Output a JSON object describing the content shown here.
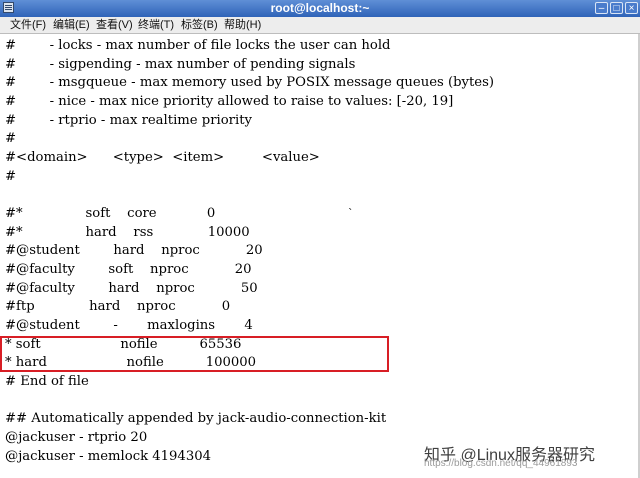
{
  "window": {
    "title": "root@localhost:~"
  },
  "menu": [
    {
      "label": "文件(F)"
    },
    {
      "label": "编辑(E)"
    },
    {
      "label": "查看(V)"
    },
    {
      "label": "终端(T)"
    },
    {
      "label": "标签(B)"
    },
    {
      "label": "帮助(H)"
    }
  ],
  "terminal": {
    "lines": [
      "#        - locks - max number of file locks the user can hold",
      "#        - sigpending - max number of pending signals",
      "#        - msgqueue - max memory used by POSIX message queues (bytes)",
      "#        - nice - max nice priority allowed to raise to values: [-20, 19]",
      "#        - rtprio - max realtime priority",
      "#",
      "#<domain>      <type>  <item>         <value>",
      "#",
      "",
      "#*               soft    core            0",
      "#*               hard    rss             10000",
      "#@student        hard    nproc           20",
      "#@faculty        soft    nproc           20",
      "#@faculty        hard    nproc           50",
      "#ftp             hard    nproc           0",
      "#@student        -       maxlogins       4",
      "* soft                   nofile          65536",
      "* hard                   nofile          100000",
      "# End of file",
      "",
      "## Automatically appended by jack-audio-connection-kit",
      "@jackuser - rtprio 20",
      "@jackuser - memlock 4194304"
    ],
    "cursor_glyph": "`"
  },
  "watermark": {
    "main": "知乎 @Linux服务器研究",
    "sub": "https://blog.csdn.net/qq_44961893"
  },
  "highlight_color": "#d81e25"
}
